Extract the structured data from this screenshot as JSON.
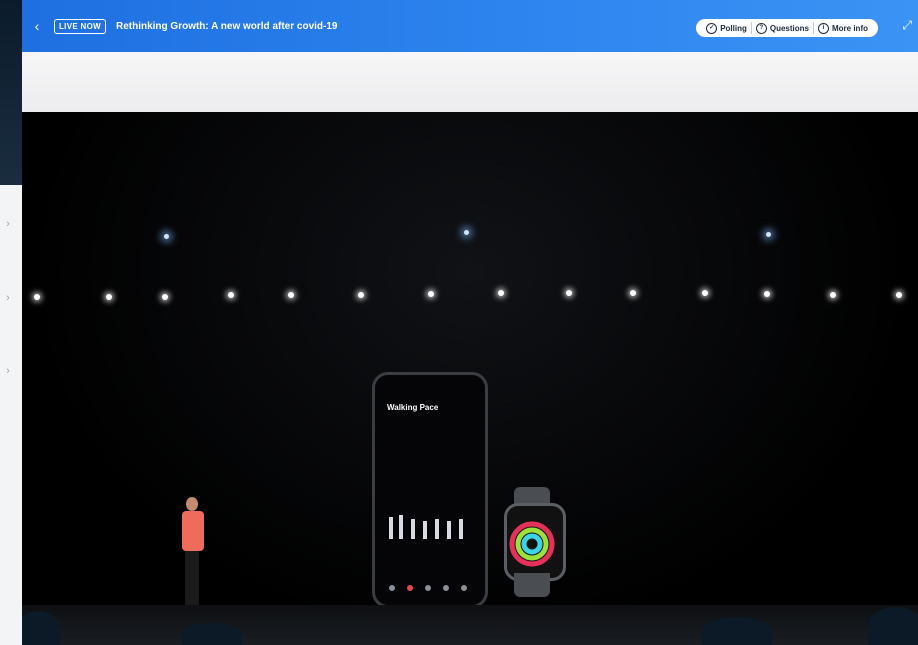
{
  "header": {
    "back_icon": "chevron-left-icon",
    "live_badge": "LIVE NOW",
    "title": "Rethinking Growth: A new world after covid-19",
    "actions": [
      {
        "label": "Polling",
        "icon": "poll-icon"
      },
      {
        "label": "Questions",
        "icon": "question-icon"
      },
      {
        "label": "More info",
        "icon": "info-icon"
      }
    ],
    "expand_icon": "expand-icon",
    "accent": "#2f86f0"
  },
  "stage": {
    "phone_screen_title": "Walking Pace"
  }
}
